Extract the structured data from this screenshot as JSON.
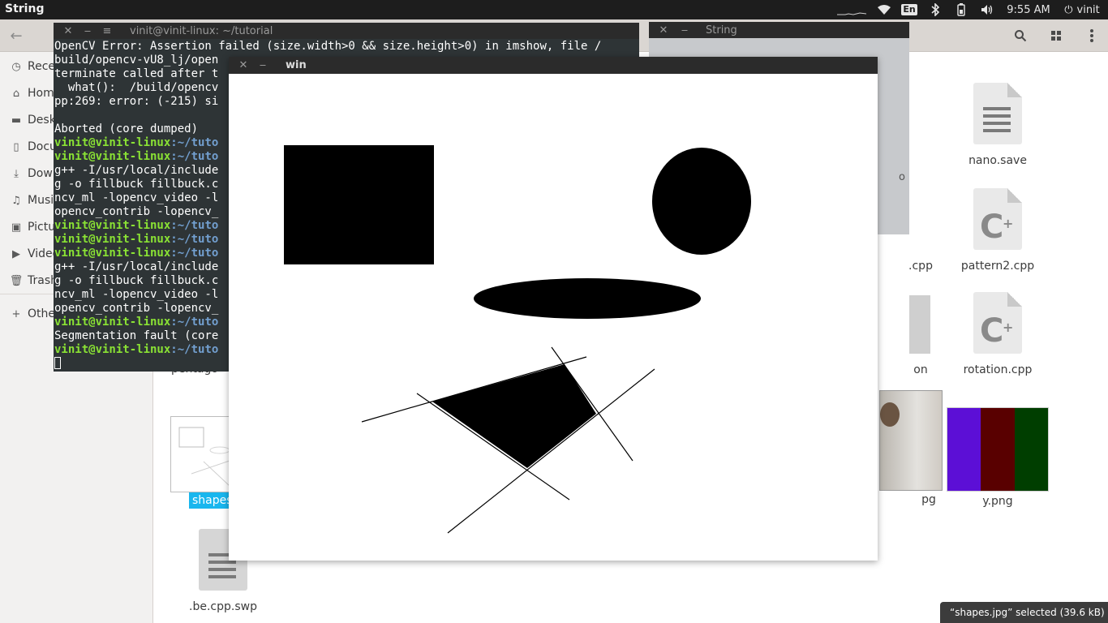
{
  "top_panel": {
    "app_title": "String",
    "lang": "En",
    "time": "9:55 AM",
    "user": "vinit"
  },
  "sidebar": {
    "items": [
      {
        "label": "Recent",
        "icon": "clock-icon"
      },
      {
        "label": "Home",
        "icon": "home-icon"
      },
      {
        "label": "Desktop",
        "icon": "desktop-icon"
      },
      {
        "label": "Documents",
        "icon": "documents-icon"
      },
      {
        "label": "Downloads",
        "icon": "downloads-icon"
      },
      {
        "label": "Music",
        "icon": "music-icon"
      },
      {
        "label": "Pictures",
        "icon": "pictures-icon"
      },
      {
        "label": "Videos",
        "icon": "videos-icon"
      },
      {
        "label": "Trash",
        "icon": "trash-icon"
      }
    ],
    "other": "Other Locations"
  },
  "files": {
    "nano_save": "nano.save",
    "cpp_partial": ".cpp",
    "pattern2": "pattern2.cpp",
    "on_partial": "on",
    "rotation": "rotation.cpp",
    "pentagon_partial": "pentago",
    "shapes_selected": "shapes",
    "jpg_partial": "pg",
    "y_png": "y.png",
    "y_png_colors": [
      "#5c0fd6",
      "#590000",
      "#003e00"
    ],
    "be_swp": ".be.cpp.swp",
    "p_partial": "o"
  },
  "status": "“shapes.jpg” selected  (39.6 kB)",
  "terminal": {
    "title": "vinit@vinit-linux: ~/tutorial",
    "lines": [
      {
        "type": "text",
        "text": "OpenCV Error: Assertion failed (size.width>0 && size.height>0) in imshow, file /"
      },
      {
        "type": "text",
        "text": "build/opencv-vU8_lj/open"
      },
      {
        "type": "text",
        "text": "terminate called after t"
      },
      {
        "type": "text",
        "text": "  what():  /build/opencv"
      },
      {
        "type": "text",
        "text": "pp:269: error: (-215) si"
      },
      {
        "type": "text",
        "text": ""
      },
      {
        "type": "text",
        "text": "Aborted (core dumped)"
      },
      {
        "type": "prompt",
        "user": "vinit@vinit-linux",
        "path": ":~/tuto",
        "cmd": ""
      },
      {
        "type": "prompt",
        "user": "vinit@vinit-linux",
        "path": ":~/tuto",
        "cmd": ""
      },
      {
        "type": "text",
        "text": "g++ -I/usr/local/include"
      },
      {
        "type": "text",
        "text": "g -o fillbuck fillbuck.c"
      },
      {
        "type": "text",
        "text": "ncv_ml -lopencv_video -l"
      },
      {
        "type": "text",
        "text": "opencv_contrib -lopencv_"
      },
      {
        "type": "prompt",
        "user": "vinit@vinit-linux",
        "path": ":~/tuto",
        "cmd": ""
      },
      {
        "type": "prompt",
        "user": "vinit@vinit-linux",
        "path": ":~/tuto",
        "cmd": ""
      },
      {
        "type": "prompt",
        "user": "vinit@vinit-linux",
        "path": ":~/tuto",
        "cmd": ""
      },
      {
        "type": "text",
        "text": "g++ -I/usr/local/include"
      },
      {
        "type": "text",
        "text": "g -o fillbuck fillbuck.c"
      },
      {
        "type": "text",
        "text": "ncv_ml -lopencv_video -l"
      },
      {
        "type": "text",
        "text": "opencv_contrib -lopencv_"
      },
      {
        "type": "prompt",
        "user": "vinit@vinit-linux",
        "path": ":~/tuto",
        "cmd": ""
      },
      {
        "type": "text",
        "text": "Segmentation fault (core"
      },
      {
        "type": "prompt",
        "user": "vinit@vinit-linux",
        "path": ":~/tuto",
        "cmd": ""
      }
    ]
  },
  "string_window": {
    "title": "String"
  },
  "cv_window": {
    "title": "win"
  },
  "colors": {
    "panel_bg": "#1d1d1d",
    "terminal_bg": "#2e3436",
    "prompt_user": "#8ae234",
    "prompt_path": "#729fcf",
    "selection": "#19b6ee"
  }
}
